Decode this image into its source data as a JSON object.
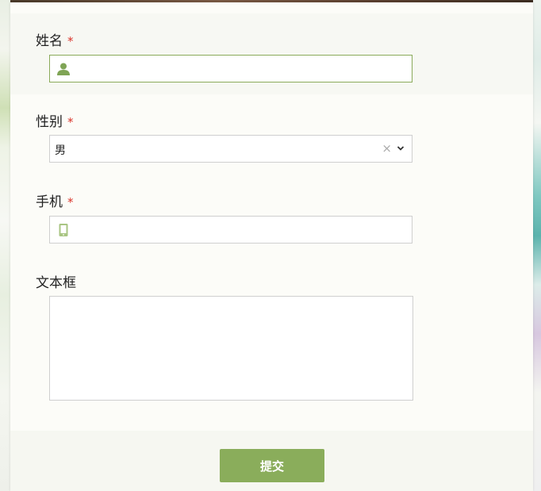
{
  "form": {
    "fields": [
      {
        "label": "姓名",
        "required_mark": "*",
        "icon": "user-icon",
        "value": ""
      },
      {
        "label": "性别",
        "required_mark": "*",
        "value": "男",
        "clear_icon": "×"
      },
      {
        "label": "手机",
        "required_mark": "*",
        "icon": "mobile-phone-icon",
        "value": ""
      },
      {
        "label": "文本框",
        "value": ""
      }
    ],
    "submit_label": "提交"
  },
  "colors": {
    "accent": "#8aad5b",
    "required": "#d9342b",
    "icon_green": "#7fa455",
    "focus_border": "#8aaa5a"
  }
}
